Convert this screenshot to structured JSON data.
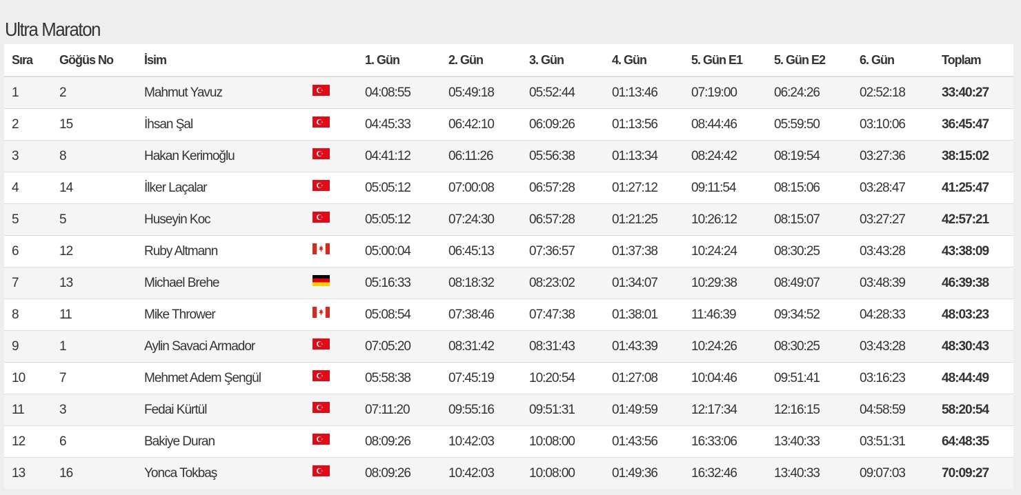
{
  "page": {
    "title": "Ultra Maraton"
  },
  "table": {
    "headers": {
      "rank": "Sıra",
      "bib": "Göğüs No",
      "name": "İsim",
      "flag": "",
      "day1": "1. Gün",
      "day2": "2. Gün",
      "day3": "3. Gün",
      "day4": "4. Gün",
      "day5e1": "5. Gün E1",
      "day5e2": "5. Gün E2",
      "day6": "6. Gün",
      "total": "Toplam"
    },
    "rows": [
      {
        "rank": "1",
        "bib": "2",
        "name": "Mahmut Yavuz",
        "country": "turkey-flag-icon",
        "day1": "04:08:55",
        "day2": "05:49:18",
        "day3": "05:52:44",
        "day4": "01:13:46",
        "day5e1": "07:19:00",
        "day5e2": "06:24:26",
        "day6": "02:52:18",
        "total": "33:40:27"
      },
      {
        "rank": "2",
        "bib": "15",
        "name": "İhsan Şal",
        "country": "turkey-flag-icon",
        "day1": "04:45:33",
        "day2": "06:42:10",
        "day3": "06:09:26",
        "day4": "01:13:56",
        "day5e1": "08:44:46",
        "day5e2": "05:59:50",
        "day6": "03:10:06",
        "total": "36:45:47"
      },
      {
        "rank": "3",
        "bib": "8",
        "name": "Hakan Kerimoğlu",
        "country": "turkey-flag-icon",
        "day1": "04:41:12",
        "day2": "06:11:26",
        "day3": "05:56:38",
        "day4": "01:13:34",
        "day5e1": "08:24:42",
        "day5e2": "08:19:54",
        "day6": "03:27:36",
        "total": "38:15:02"
      },
      {
        "rank": "4",
        "bib": "14",
        "name": "İlker Laçalar",
        "country": "turkey-flag-icon",
        "day1": "05:05:12",
        "day2": "07:00:08",
        "day3": "06:57:28",
        "day4": "01:27:12",
        "day5e1": "09:11:54",
        "day5e2": "08:15:06",
        "day6": "03:28:47",
        "total": "41:25:47"
      },
      {
        "rank": "5",
        "bib": "5",
        "name": "Huseyin Koc",
        "country": "turkey-flag-icon",
        "day1": "05:05:12",
        "day2": "07:24:30",
        "day3": "06:57:28",
        "day4": "01:21:25",
        "day5e1": "10:26:12",
        "day5e2": "08:15:07",
        "day6": "03:27:27",
        "total": "42:57:21"
      },
      {
        "rank": "6",
        "bib": "12",
        "name": "Ruby Altmann",
        "country": "canada-flag-icon",
        "day1": "05:00:04",
        "day2": "06:45:13",
        "day3": "07:36:57",
        "day4": "01:37:38",
        "day5e1": "10:24:24",
        "day5e2": "08:30:25",
        "day6": "03:43:28",
        "total": "43:38:09"
      },
      {
        "rank": "7",
        "bib": "13",
        "name": "Michael Brehe",
        "country": "germany-flag-icon",
        "day1": "05:16:33",
        "day2": "08:18:32",
        "day3": "08:23:02",
        "day4": "01:34:07",
        "day5e1": "10:29:38",
        "day5e2": "08:49:07",
        "day6": "03:48:39",
        "total": "46:39:38"
      },
      {
        "rank": "8",
        "bib": "11",
        "name": "Mike Thrower",
        "country": "canada-flag-icon",
        "day1": "05:08:54",
        "day2": "07:38:46",
        "day3": "07:47:38",
        "day4": "01:38:01",
        "day5e1": "11:46:39",
        "day5e2": "09:34:52",
        "day6": "04:28:33",
        "total": "48:03:23"
      },
      {
        "rank": "9",
        "bib": "1",
        "name": "Aylin Savaci Armador",
        "country": "turkey-flag-icon",
        "day1": "07:05:20",
        "day2": "08:31:42",
        "day3": "08:31:43",
        "day4": "01:43:39",
        "day5e1": "10:24:26",
        "day5e2": "08:30:25",
        "day6": "03:43:28",
        "total": "48:30:43"
      },
      {
        "rank": "10",
        "bib": "7",
        "name": "Mehmet Adem Şengül",
        "country": "turkey-flag-icon",
        "day1": "05:58:38",
        "day2": "07:45:19",
        "day3": "10:20:54",
        "day4": "01:27:08",
        "day5e1": "10:04:46",
        "day5e2": "09:51:41",
        "day6": "03:16:23",
        "total": "48:44:49"
      },
      {
        "rank": "11",
        "bib": "3",
        "name": "Fedai Kürtül",
        "country": "turkey-flag-icon",
        "day1": "07:11:20",
        "day2": "09:55:16",
        "day3": "09:51:31",
        "day4": "01:49:59",
        "day5e1": "12:17:34",
        "day5e2": "12:16:15",
        "day6": "04:58:59",
        "total": "58:20:54"
      },
      {
        "rank": "12",
        "bib": "6",
        "name": "Bakiye Duran",
        "country": "turkey-flag-icon",
        "day1": "08:09:26",
        "day2": "10:42:03",
        "day3": "10:08:00",
        "day4": "01:43:56",
        "day5e1": "16:33:06",
        "day5e2": "13:40:33",
        "day6": "03:51:31",
        "total": "64:48:35"
      },
      {
        "rank": "13",
        "bib": "16",
        "name": "Yonca Tokbaş",
        "country": "turkey-flag-icon",
        "day1": "08:09:26",
        "day2": "10:42:03",
        "day3": "10:08:00",
        "day4": "01:49:36",
        "day5e1": "16:32:46",
        "day5e2": "13:40:33",
        "day6": "09:07:03",
        "total": "70:09:27"
      }
    ]
  },
  "colors": {
    "background": "#eeeeee",
    "row_alt": "#f5f5f5",
    "row": "#ffffff",
    "border": "#dddddd",
    "text": "#333333",
    "turkey_red": "#e30a17",
    "canada_red": "#d52b1e"
  }
}
